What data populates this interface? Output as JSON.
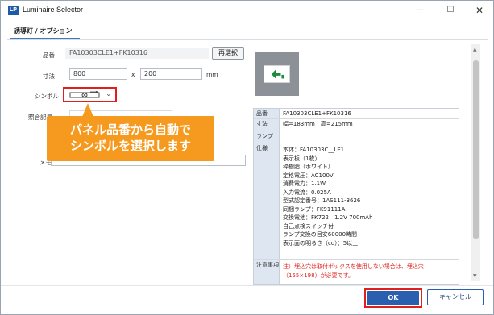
{
  "window": {
    "logo": "LP",
    "title": "Luminaire Selector",
    "minimize_glyph": "—",
    "maximize_glyph": "☐",
    "close_glyph": "✕"
  },
  "tab": {
    "label": "誘導灯 / オプション"
  },
  "form": {
    "part_no_label": "品番",
    "part_no_value": "FA10303CLE1+FK10316",
    "reselect_label": "再選択",
    "size_label": "寸法",
    "width_value": "800",
    "times": "x",
    "height_value": "200",
    "unit": "mm",
    "symbol_label": "シンボル",
    "ref_label": "照合記号",
    "memo_label": "メモ"
  },
  "callout": {
    "line1": "パネル品番から自動で",
    "line2": "シンボルを選択します",
    "color": "#f59a1e"
  },
  "spec": {
    "part_no_key": "品番",
    "part_no_val": "FA10303CLE1+FK10316",
    "size_key": "寸法",
    "size_val": "幅=183mm　高=215mm",
    "lamp_key": "ランプ",
    "lamp_val": "",
    "spec_key": "仕様",
    "spec_lines": [
      "本体：FA10303C__LE1",
      "表示板（1枚）",
      "枠樹脂（ホワイト）",
      "定格電圧：AC100V",
      "消費電力：1.1W",
      "入力電流：0.025A",
      "型式認定番号：1AS111-3626",
      "同梱ランプ：FK91111A",
      "交換電池：FK722　1.2V 700mAh",
      "自己点検スイッチ付",
      "ランプ交換の目安60000時間",
      "表示面の明るさ（cd）：5以上"
    ],
    "note_key": "注意事項",
    "note_lines": [
      "注）埋込穴は取付ボックスを使用しない場合は、埋込穴",
      "（155×198）が必要です。"
    ]
  },
  "buttons": {
    "ok": "OK",
    "cancel": "キャンセル"
  },
  "colors": {
    "accent": "#2a5fb0",
    "highlight": "#e0201c",
    "table_header": "#dde6f1"
  }
}
